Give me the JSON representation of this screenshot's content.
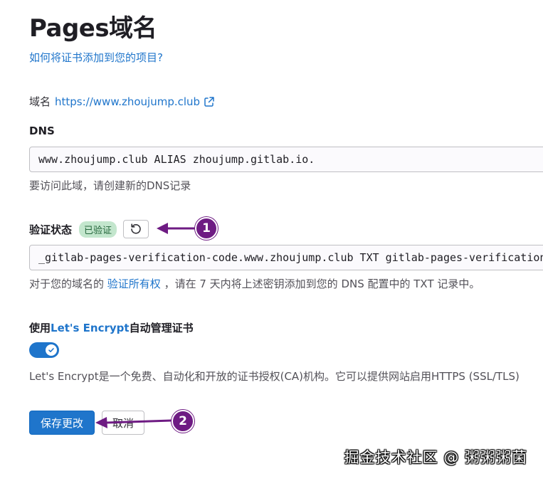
{
  "page": {
    "title": "Pages域名",
    "help_link": "如何将证书添加到您的项目?"
  },
  "domain": {
    "label": "域名",
    "url": "https://www.zhoujump.club",
    "link_icon": "external-link-icon"
  },
  "dns": {
    "label": "DNS",
    "value": "www.zhoujump.club ALIAS zhoujump.gitlab.io.",
    "help": "要访问此域，请创建新的DNS记录"
  },
  "verification": {
    "label": "验证状态",
    "badge": "已验证",
    "retry_icon": "retry-icon",
    "value": "_gitlab-pages-verification-code.www.zhoujump.club TXT gitlab-pages-verification-code=",
    "help_prefix": "对于您的域名的",
    "help_link": "验证所有权",
    "help_suffix": "，请在 7 天内将上述密钥添加到您的 DNS 配置中的 TXT 记录中。"
  },
  "letsencrypt": {
    "label_prefix": "使用",
    "label_link": "Let's Encrypt",
    "label_suffix": "自动管理证书",
    "enabled": true,
    "help": "Let's Encrypt是一个免费、自动化和开放的证书授权(CA)机构。它可以提供网站启用HTTPS (SSL/TLS)"
  },
  "actions": {
    "save": "保存更改",
    "cancel": "取消"
  },
  "callouts": [
    "1",
    "2"
  ],
  "watermark": "掘金技术社区 @ 粥粥粥菌",
  "colors": {
    "link": "#1f75cb",
    "primary": "#1f75cb",
    "badge_bg": "#c3e6cd",
    "badge_text": "#24663b",
    "callout": "#6e1b83"
  }
}
